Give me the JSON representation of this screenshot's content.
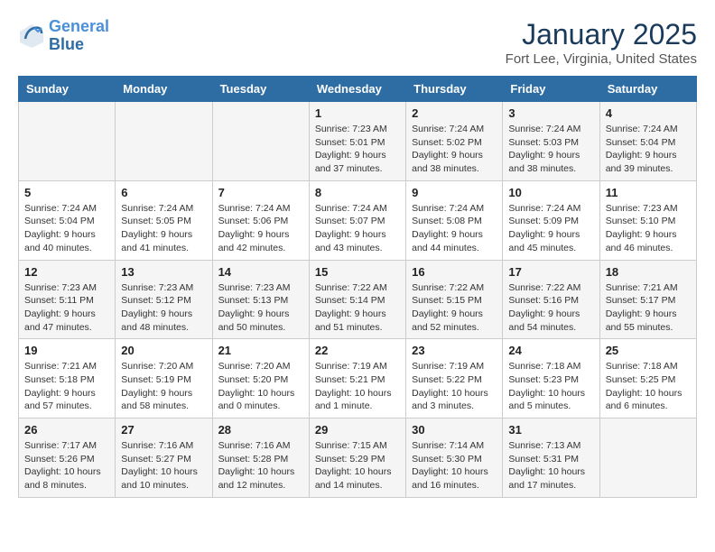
{
  "logo": {
    "line1": "General",
    "line2": "Blue"
  },
  "title": "January 2025",
  "location": "Fort Lee, Virginia, United States",
  "days_of_week": [
    "Sunday",
    "Monday",
    "Tuesday",
    "Wednesday",
    "Thursday",
    "Friday",
    "Saturday"
  ],
  "weeks": [
    {
      "days": [
        {
          "num": "",
          "info": ""
        },
        {
          "num": "",
          "info": ""
        },
        {
          "num": "",
          "info": ""
        },
        {
          "num": "1",
          "info": "Sunrise: 7:23 AM\nSunset: 5:01 PM\nDaylight: 9 hours\nand 37 minutes."
        },
        {
          "num": "2",
          "info": "Sunrise: 7:24 AM\nSunset: 5:02 PM\nDaylight: 9 hours\nand 38 minutes."
        },
        {
          "num": "3",
          "info": "Sunrise: 7:24 AM\nSunset: 5:03 PM\nDaylight: 9 hours\nand 38 minutes."
        },
        {
          "num": "4",
          "info": "Sunrise: 7:24 AM\nSunset: 5:04 PM\nDaylight: 9 hours\nand 39 minutes."
        }
      ]
    },
    {
      "days": [
        {
          "num": "5",
          "info": "Sunrise: 7:24 AM\nSunset: 5:04 PM\nDaylight: 9 hours\nand 40 minutes."
        },
        {
          "num": "6",
          "info": "Sunrise: 7:24 AM\nSunset: 5:05 PM\nDaylight: 9 hours\nand 41 minutes."
        },
        {
          "num": "7",
          "info": "Sunrise: 7:24 AM\nSunset: 5:06 PM\nDaylight: 9 hours\nand 42 minutes."
        },
        {
          "num": "8",
          "info": "Sunrise: 7:24 AM\nSunset: 5:07 PM\nDaylight: 9 hours\nand 43 minutes."
        },
        {
          "num": "9",
          "info": "Sunrise: 7:24 AM\nSunset: 5:08 PM\nDaylight: 9 hours\nand 44 minutes."
        },
        {
          "num": "10",
          "info": "Sunrise: 7:24 AM\nSunset: 5:09 PM\nDaylight: 9 hours\nand 45 minutes."
        },
        {
          "num": "11",
          "info": "Sunrise: 7:23 AM\nSunset: 5:10 PM\nDaylight: 9 hours\nand 46 minutes."
        }
      ]
    },
    {
      "days": [
        {
          "num": "12",
          "info": "Sunrise: 7:23 AM\nSunset: 5:11 PM\nDaylight: 9 hours\nand 47 minutes."
        },
        {
          "num": "13",
          "info": "Sunrise: 7:23 AM\nSunset: 5:12 PM\nDaylight: 9 hours\nand 48 minutes."
        },
        {
          "num": "14",
          "info": "Sunrise: 7:23 AM\nSunset: 5:13 PM\nDaylight: 9 hours\nand 50 minutes."
        },
        {
          "num": "15",
          "info": "Sunrise: 7:22 AM\nSunset: 5:14 PM\nDaylight: 9 hours\nand 51 minutes."
        },
        {
          "num": "16",
          "info": "Sunrise: 7:22 AM\nSunset: 5:15 PM\nDaylight: 9 hours\nand 52 minutes."
        },
        {
          "num": "17",
          "info": "Sunrise: 7:22 AM\nSunset: 5:16 PM\nDaylight: 9 hours\nand 54 minutes."
        },
        {
          "num": "18",
          "info": "Sunrise: 7:21 AM\nSunset: 5:17 PM\nDaylight: 9 hours\nand 55 minutes."
        }
      ]
    },
    {
      "days": [
        {
          "num": "19",
          "info": "Sunrise: 7:21 AM\nSunset: 5:18 PM\nDaylight: 9 hours\nand 57 minutes."
        },
        {
          "num": "20",
          "info": "Sunrise: 7:20 AM\nSunset: 5:19 PM\nDaylight: 9 hours\nand 58 minutes."
        },
        {
          "num": "21",
          "info": "Sunrise: 7:20 AM\nSunset: 5:20 PM\nDaylight: 10 hours\nand 0 minutes."
        },
        {
          "num": "22",
          "info": "Sunrise: 7:19 AM\nSunset: 5:21 PM\nDaylight: 10 hours\nand 1 minute."
        },
        {
          "num": "23",
          "info": "Sunrise: 7:19 AM\nSunset: 5:22 PM\nDaylight: 10 hours\nand 3 minutes."
        },
        {
          "num": "24",
          "info": "Sunrise: 7:18 AM\nSunset: 5:23 PM\nDaylight: 10 hours\nand 5 minutes."
        },
        {
          "num": "25",
          "info": "Sunrise: 7:18 AM\nSunset: 5:25 PM\nDaylight: 10 hours\nand 6 minutes."
        }
      ]
    },
    {
      "days": [
        {
          "num": "26",
          "info": "Sunrise: 7:17 AM\nSunset: 5:26 PM\nDaylight: 10 hours\nand 8 minutes."
        },
        {
          "num": "27",
          "info": "Sunrise: 7:16 AM\nSunset: 5:27 PM\nDaylight: 10 hours\nand 10 minutes."
        },
        {
          "num": "28",
          "info": "Sunrise: 7:16 AM\nSunset: 5:28 PM\nDaylight: 10 hours\nand 12 minutes."
        },
        {
          "num": "29",
          "info": "Sunrise: 7:15 AM\nSunset: 5:29 PM\nDaylight: 10 hours\nand 14 minutes."
        },
        {
          "num": "30",
          "info": "Sunrise: 7:14 AM\nSunset: 5:30 PM\nDaylight: 10 hours\nand 16 minutes."
        },
        {
          "num": "31",
          "info": "Sunrise: 7:13 AM\nSunset: 5:31 PM\nDaylight: 10 hours\nand 17 minutes."
        },
        {
          "num": "",
          "info": ""
        }
      ]
    }
  ]
}
